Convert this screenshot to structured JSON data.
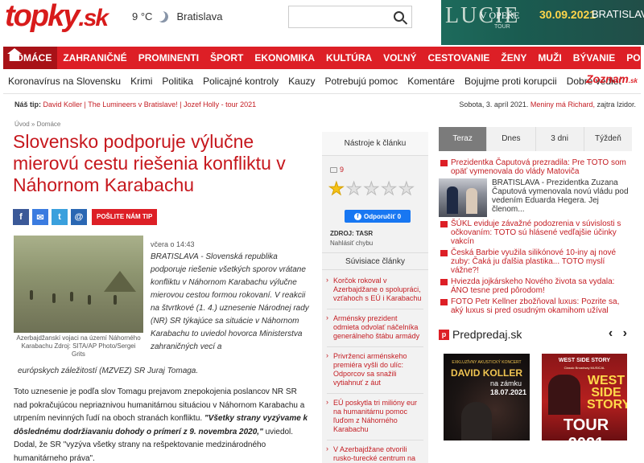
{
  "header": {
    "logo_text": "topky",
    "logo_tld": ".sk",
    "weather_temp": "9 °C",
    "weather_city": "Bratislava",
    "search_placeholder": ""
  },
  "ad": {
    "title": "LUCIE",
    "subtitle": "V OPEŘE",
    "tour": "TOUR",
    "date": "30.09.2021",
    "place": "BRATISLAVA"
  },
  "nav": {
    "items": [
      "DOMÁCE",
      "ZAHRANIČNÉ",
      "PROMINENTI",
      "ŠPORT",
      "EKONOMIKA",
      "KULTÚRA",
      "VOĽNÝ ČAS",
      "CESTOVANIE",
      "ŽENY",
      "MUŽI",
      "BÝVANIE",
      "POHODO"
    ]
  },
  "subnav": {
    "items": [
      "Koronavírus na Slovensku",
      "Krimi",
      "Politika",
      "Policajné kontroly",
      "Kauzy",
      "Potrebujú pomoc",
      "Komentáre",
      "Bojujme proti korupcii",
      "Dobre vedieť"
    ],
    "partner": "Zoznam",
    "partner_tld": ".sk"
  },
  "tips": {
    "label": "Náš tip:",
    "text": "David Koller | The Lumineers v Bratislave! | Jozef Holly - tour 2021"
  },
  "dateline": {
    "date": "Sobota, 3. apríl 2021.",
    "nameday": "Meniny má Richard,",
    "tomorrow": "zajtra Izidor."
  },
  "breadcrumb": "Úvod » Domáce",
  "article": {
    "title": "Slovensko podporuje výlučne mierovú cestu riešenia konfliktu v Náhornom Karabachu",
    "share_tip": "POŠLITE NÁM TIP",
    "photo_caption": "Azerbajdžanskí vojaci na území Náhorného Karabachu Zdroj: SITA/AP Photo/Sergei Grits",
    "time": "včera o 14:43",
    "lead": "BRATISLAVA - Slovenská republika podporuje riešenie všetkých sporov vrátane konfliktu v Náhornom Karabachu výlučne mierovou cestou formou rokovaní. V reakcii na štvrtkové (1. 4.) uznesenie Národnej rady (NR) SR týkajúce sa situácie v Náhornom Karabachu to uviedol hovorca Ministerstva zahraničných vecí a",
    "lead_tail": "európskych záležitostí (MZVEZ) SR Juraj Tomaga.",
    "body_1": "Toto uznesenie je podľa slov Tomagu prejavom znepokojenia poslancov NR SR nad pokračujúcou nepriaznivou humanitárnou situáciou v Náhornom Karabachu a utrpením nevinných ľudí na oboch stranách konfliktu.",
    "body_quote": "\"Všetky strany vyzývame k dôslednému dodržiavaniu dohody o prímerí z 9. novembra 2020,\"",
    "body_2": "uviedol. Dodal, že SR \"vyzýva všetky strany na rešpektovanie medzinárodného humanitárneho práva\"."
  },
  "tools": {
    "header": "Nástroje k článku",
    "comments": "9",
    "rating_on": 1,
    "rating_total": 5,
    "fb_button": "Odporučiť 0",
    "source": "ZDROJ: TASR",
    "report": "Nahlásiť chybu",
    "related_header": "Súvisiace články",
    "related": [
      "Korčok rokoval v Azerbajdžane o spolupráci, vzťahoch s EÚ i Karabachu",
      "Arménsky prezident odmieta odvolať náčelníka generálneho štábu armády",
      "Privrženci arménskeho premiéra vyšli do ulíc: Odporcov sa snažili vytiahnuť z áut",
      "EÚ poskytla tri milióny eur na humanitárnu pomoc ľuďom z Náhorného Karabachu",
      "V Azerbajdžane otvorili rusko-turecké centrum na kontrolu prímeria v"
    ]
  },
  "trending": {
    "tabs": [
      "Teraz",
      "Dnes",
      "3 dni",
      "Týždeň"
    ],
    "active_tab": "Teraz",
    "first": "Prezidentka Čaputová prezradila: Pre TOTO som opäť vymenovala do vlády Matoviča",
    "featured_text": "BRATISLAVA - Prezidentka Zuzana Čaputová vymenovala novú vládu pod vedením Eduarda Hegera. Jej členom...",
    "items": [
      "ŠÚKL eviduje závažné podozrenia v súvislosti s očkovaním: TOTO sú hlásené vedľajšie účinky vakcín",
      "Česká Barbie využila silikónové 10-iny aj nové zuby: Čaká ju ďalšia plastika... TOTO myslí vážne?!",
      "Hviezda jojkárskeho Nového života sa vydala: ÁNO tesne pred pôrodom!",
      "FOTO Petr Kellner zbožňoval luxus: Pozrite sa, aký luxus si pred osudným okamihom užíval"
    ]
  },
  "predpredaj": {
    "logo": "p",
    "name": "Predpredaj.sk",
    "arrows": "‹ ›",
    "poster1": {
      "top": "EXKLUZÍVNY AKUSTICKÝ KONCERT",
      "name": "DAVID KOLLER",
      "venue": "na zámku",
      "date": "18.07.2021"
    },
    "poster2": {
      "top": "WEST SIDE STORY",
      "sub": "Classic Broadway MUSICAL",
      "logo": "WEST SIDE STORY",
      "tour": "TOUR 2021"
    }
  }
}
